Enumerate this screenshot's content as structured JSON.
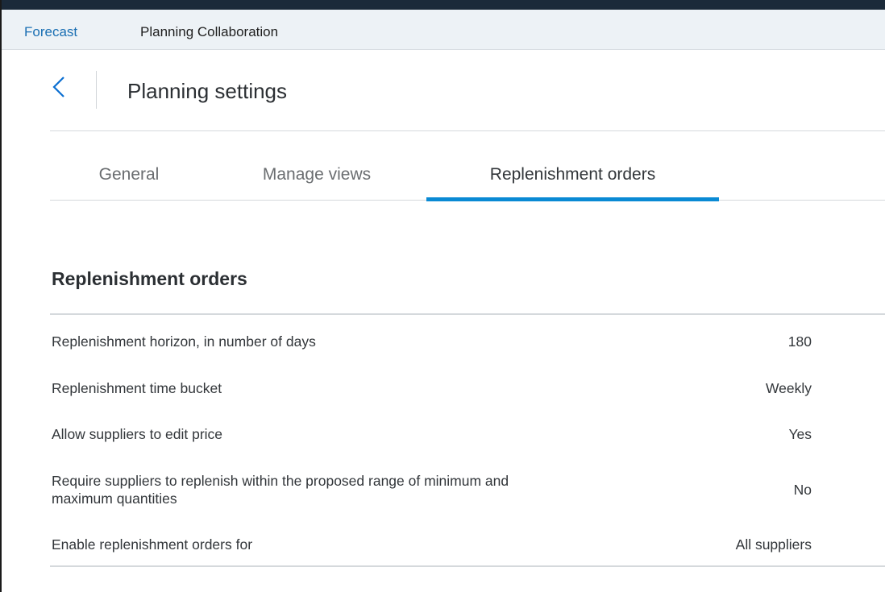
{
  "topnav": {
    "items": [
      {
        "label": "Forecast"
      },
      {
        "label": "Planning Collaboration"
      }
    ]
  },
  "header": {
    "back_icon": "chevron-left-icon",
    "title": "Planning settings"
  },
  "tabs": [
    {
      "label": "General",
      "active": false
    },
    {
      "label": "Manage views",
      "active": false
    },
    {
      "label": "Replenishment orders",
      "active": true
    }
  ],
  "section": {
    "title": "Replenishment orders",
    "rows": [
      {
        "label": "Replenishment horizon, in number of days",
        "value": "180"
      },
      {
        "label": "Replenishment time bucket",
        "value": "Weekly"
      },
      {
        "label": "Allow suppliers to edit price",
        "value": "Yes"
      },
      {
        "label": "Require suppliers to replenish within the proposed range of minimum and maximum quantities",
        "value": "No"
      },
      {
        "label": "Enable replenishment orders for",
        "value": "All suppliers"
      }
    ]
  },
  "colors": {
    "accent": "#0a8ad4",
    "link": "#1a6fb3",
    "nav_background": "#edf2f6",
    "top_strip": "#1b2a3a"
  }
}
